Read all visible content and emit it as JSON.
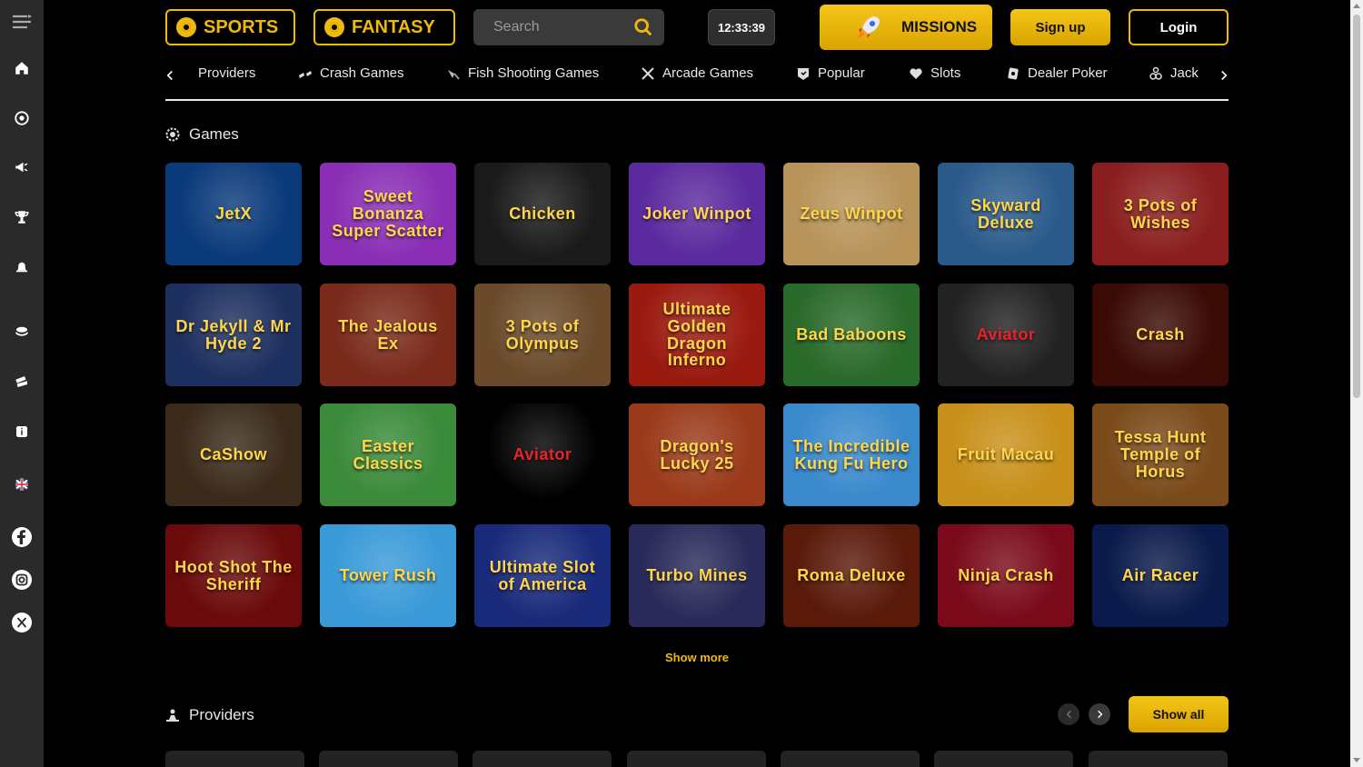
{
  "header": {
    "sports_label": "SPORTS",
    "fantasy_label": "FANTASY",
    "search_placeholder": "Search",
    "clock": "12:33:39",
    "missions_label": "MISSIONS",
    "signup_label": "Sign up",
    "login_label": "Login"
  },
  "categories": [
    {
      "label": "Providers",
      "icon": "none"
    },
    {
      "label": "Crash Games",
      "icon": "crash-icon"
    },
    {
      "label": "Fish Shooting Games",
      "icon": "fish-icon"
    },
    {
      "label": "Arcade Games",
      "icon": "swords-icon"
    },
    {
      "label": "Popular",
      "icon": "popular-icon"
    },
    {
      "label": "Slots",
      "icon": "heart-icon"
    },
    {
      "label": "Dealer Poker",
      "icon": "cards-icon"
    },
    {
      "label": "Jack",
      "icon": "jackpot-icon"
    }
  ],
  "games_section": {
    "title": "Games"
  },
  "games": [
    {
      "name": "JetX",
      "bg": "#0a3a7a"
    },
    {
      "name": "Sweet Bonanza Super Scatter",
      "bg": "#8a2fb5"
    },
    {
      "name": "Chicken",
      "bg": "#1a1a1a"
    },
    {
      "name": "Joker Winpot",
      "bg": "#5b2a9e"
    },
    {
      "name": "Zeus Winpot",
      "bg": "#b8945a"
    },
    {
      "name": "Skyward Deluxe",
      "bg": "#2a5a8a"
    },
    {
      "name": "3 Pots of Wishes",
      "bg": "#8a1e1e"
    },
    {
      "name": "Dr Jekyll & Mr Hyde 2",
      "bg": "#1e3060"
    },
    {
      "name": "The Jealous Ex",
      "bg": "#7a2a1a"
    },
    {
      "name": "3 Pots of Olympus",
      "bg": "#6a4a2a"
    },
    {
      "name": "Ultimate Golden Dragon Inferno",
      "bg": "#9a1a10"
    },
    {
      "name": "Bad Baboons",
      "bg": "#2a6a2a"
    },
    {
      "name": "Aviator",
      "bg": "#222222"
    },
    {
      "name": "Crash",
      "bg": "#3a0a05"
    },
    {
      "name": "CaShow",
      "bg": "#3a2a1a"
    },
    {
      "name": "Easter Classics",
      "bg": "#3a8a3a"
    },
    {
      "name": "Aviator",
      "bg": "#000000"
    },
    {
      "name": "Dragon's Lucky 25",
      "bg": "#9a3a1a"
    },
    {
      "name": "The Incredible Kung Fu Hero",
      "bg": "#3a8acc"
    },
    {
      "name": "Fruit Macau",
      "bg": "#c8901a"
    },
    {
      "name": "Tessa Hunt Temple of Horus",
      "bg": "#7a4a1a"
    },
    {
      "name": "Hoot Shot The Sheriff",
      "bg": "#6a0a0a"
    },
    {
      "name": "Tower Rush",
      "bg": "#3a9ad8"
    },
    {
      "name": "Ultimate Slot of America",
      "bg": "#1a2a7a"
    },
    {
      "name": "Turbo Mines",
      "bg": "#2a2a5a"
    },
    {
      "name": "Roma Deluxe",
      "bg": "#5a1a0a"
    },
    {
      "name": "Ninja Crash",
      "bg": "#7a0a1a"
    },
    {
      "name": "Air Racer",
      "bg": "#0a1a4a"
    }
  ],
  "show_more_label": "Show more",
  "providers_section": {
    "title": "Providers",
    "show_all_label": "Show all"
  },
  "colors": {
    "accent": "#f0b90b",
    "sidebar": "#2a2a2a",
    "background": "#000000"
  }
}
